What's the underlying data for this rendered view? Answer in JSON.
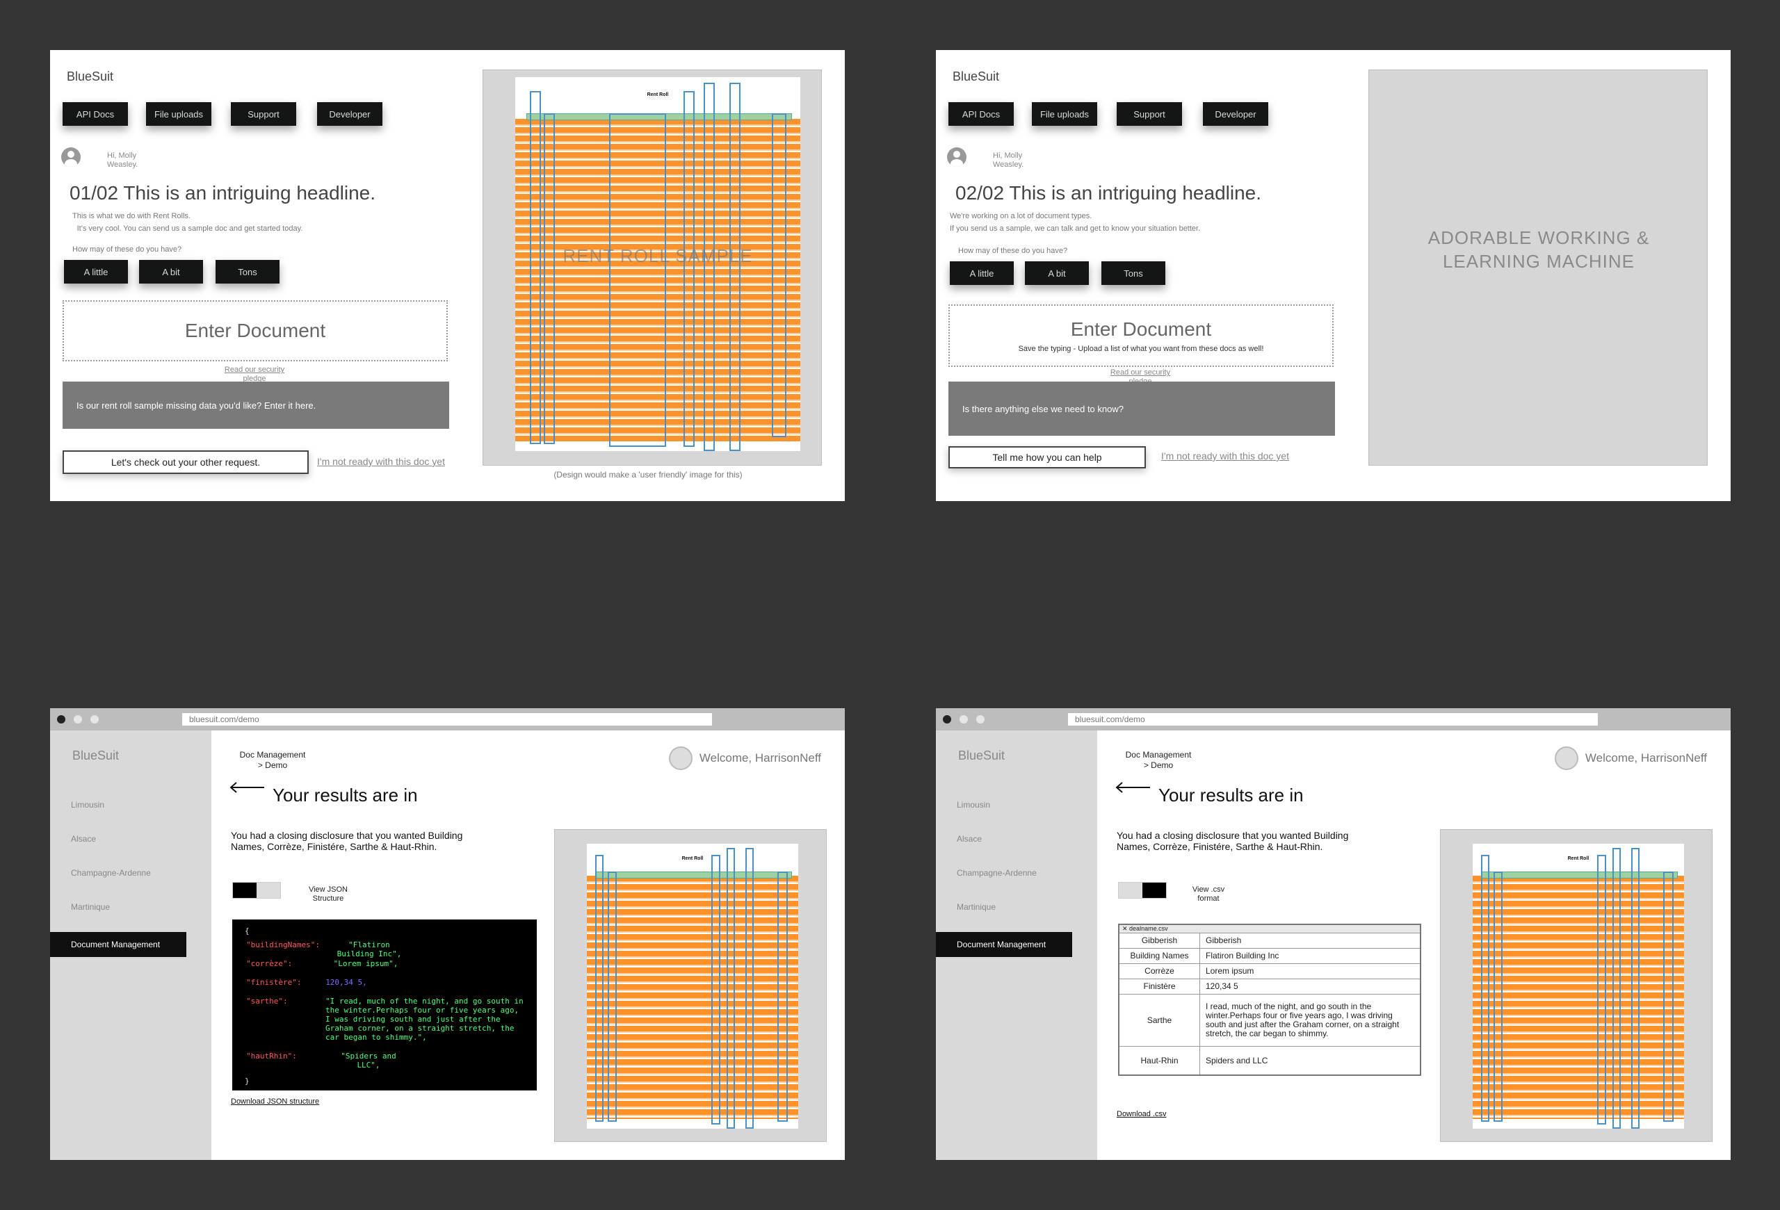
{
  "brand": "BlueSuit",
  "nav": [
    "API Docs",
    "File uploads",
    "Support",
    "Developer"
  ],
  "greeting": "Hi, Molly Weasley.",
  "colors": {
    "dark_button": "#141616",
    "grey_input": "#7a7a7a",
    "highlight_orange": "#ff8c1e",
    "box_blue": "#4a90c8",
    "json_key": "#ff5a5a",
    "json_string": "#4cff7a",
    "json_number": "#7a6cff"
  },
  "screen1": {
    "headline": "01/02 This is an intriguing headline.",
    "intro_line1": "This is what we do with Rent Rolls.",
    "intro_line2": "It's very cool. You can send us a sample doc and get started today.",
    "question": "How may of these do you have?",
    "choices": [
      "A little",
      "A bit",
      "Tons"
    ],
    "enter_document": "Enter Document",
    "security_link": "Read our security pledge",
    "missing_prompt": "Is our rent roll sample missing data you'd like? Enter it here.",
    "primary_button": "Let's check out your other request.",
    "not_ready": "I'm not ready with this doc yet",
    "doc_overlay": "RENT ROLL SAMPLE",
    "doc_title": "Rent Roll",
    "caption": "(Design would make a 'user friendly' image for this)"
  },
  "screen2": {
    "headline": "02/02 This is an intriguing headline.",
    "intro_line1": "We're working on a lot of document types.",
    "intro_line2": "If you send us a sample, we can talk and get to know your situation better.",
    "question": "How may of these do you have?",
    "choices": [
      "A little",
      "A bit",
      "Tons"
    ],
    "enter_document": "Enter Document",
    "upload_hint": "Save the typing - Upload a list of what you want from these docs as well!",
    "security_link": "Read our security pledge",
    "anything_else": "Is there anything else we need to know?",
    "primary_button": "Tell me how you can help",
    "not_ready": "I'm not ready with this doc yet",
    "placeholder_image": "ADORABLE WORKING & LEARNING MACHINE"
  },
  "app": {
    "url": "bluesuit.com/demo",
    "sidebar": [
      "Limousin",
      "Alsace",
      "Champagne-Ardenne",
      "Martinique"
    ],
    "sidebar_active": "Document Management",
    "breadcrumb": "Doc Management > Demo",
    "welcome": "Welcome, HarrisonNeff",
    "results_title": "Your results are in",
    "results_text": "You had a closing disclosure that you wanted Building Names, Corrèze, Finistére, Sarthe & Haut-Rhin.",
    "doc_title": "Rent Roll"
  },
  "screen3": {
    "toggle_label": "View JSON Structure",
    "json": {
      "open": "{",
      "k1": "\"buildingNames\":",
      "v1": "\"Flatiron Building Inc\",",
      "k2": "\"corrèze\":",
      "v2": "\"Lorem ipsum\",",
      "k3": "\"finistère\":",
      "v3": "120,34 5,",
      "k4": "\"sarthe\":",
      "v4": "\"I read, much of the night, and go south in the winter.Perhaps four or five years ago, I was driving south and just after the Graham corner, on a straight stretch, the car began to shimmy.\",",
      "k5": "\"hautRhin\":",
      "v5": "\"Spiders and LLC\",",
      "close": "}"
    },
    "download": "Download JSON structure"
  },
  "screen4": {
    "toggle_label": "View .csv format",
    "csv_filename": "dealname.csv",
    "rows": [
      {
        "k": "Gibberish",
        "v": "Gibberish"
      },
      {
        "k": "Building Names",
        "v": "Flatiron Building Inc"
      },
      {
        "k": "Corrèze",
        "v": "Lorem ipsum"
      },
      {
        "k": "Finistère",
        "v": "120,34 5"
      },
      {
        "k": "Sarthe",
        "v": "I read, much of the night, and go south in the winter.Perhaps four or five years ago, I was driving south and just after the Graham corner, on a straight stretch, the car began to shimmy."
      },
      {
        "k": "Haut-Rhin",
        "v": "Spiders and LLC"
      }
    ],
    "download": "Download .csv"
  }
}
